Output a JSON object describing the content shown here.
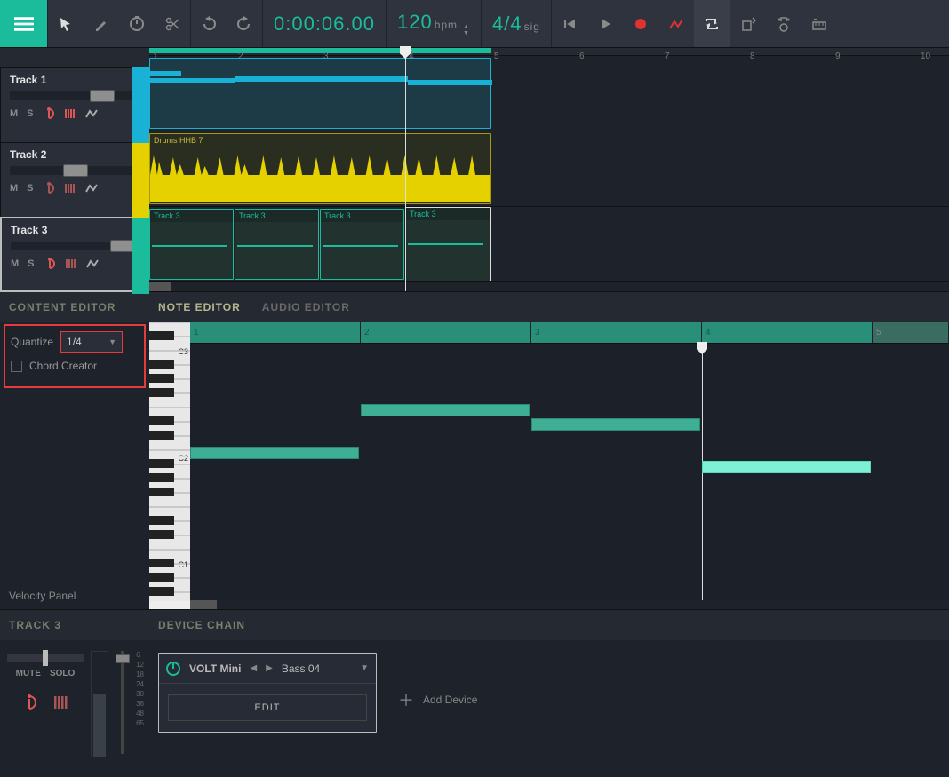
{
  "toolbar": {
    "timecode": "0:00:06.00",
    "tempo": "120",
    "tempo_unit": "bpm",
    "timesig": "4/4",
    "timesig_unit": "sig"
  },
  "ruler_ticks": [
    1,
    2,
    3,
    4,
    5,
    6,
    7,
    8,
    9,
    10
  ],
  "tracks": [
    {
      "name": "Track 1",
      "m": "M",
      "s": "S",
      "color": "cs-blue",
      "selected": false
    },
    {
      "name": "Track 2",
      "m": "M",
      "s": "S",
      "color": "cs-yellow",
      "selected": false
    },
    {
      "name": "Track 3",
      "m": "M",
      "s": "S",
      "color": "cs-green",
      "selected": true
    }
  ],
  "clip_yellow_label": "Drums HHB 7",
  "clip_green_label": "Track 3",
  "content_editor": {
    "title": "CONTENT EDITOR",
    "quantize_label": "Quantize",
    "quantize_value": "1/4",
    "chord_label": "Chord Creator",
    "velocity_label": "Velocity Panel"
  },
  "tabs": {
    "note": "NOTE EDITOR",
    "audio": "AUDIO EDITOR"
  },
  "note_ruler": [
    "1",
    "2",
    "3",
    "4",
    "5"
  ],
  "piano_labels": [
    "C3",
    "C2",
    "C1"
  ],
  "mixer": {
    "head": "TRACK 3",
    "mute": "MUTE",
    "solo": "SOLO",
    "scale": [
      "6",
      "12",
      "18",
      "24",
      "30",
      "36",
      "48",
      "65"
    ]
  },
  "device": {
    "head": "DEVICE CHAIN",
    "name": "VOLT Mini",
    "preset": "Bass 04",
    "edit": "EDIT",
    "add": "Add Device"
  }
}
